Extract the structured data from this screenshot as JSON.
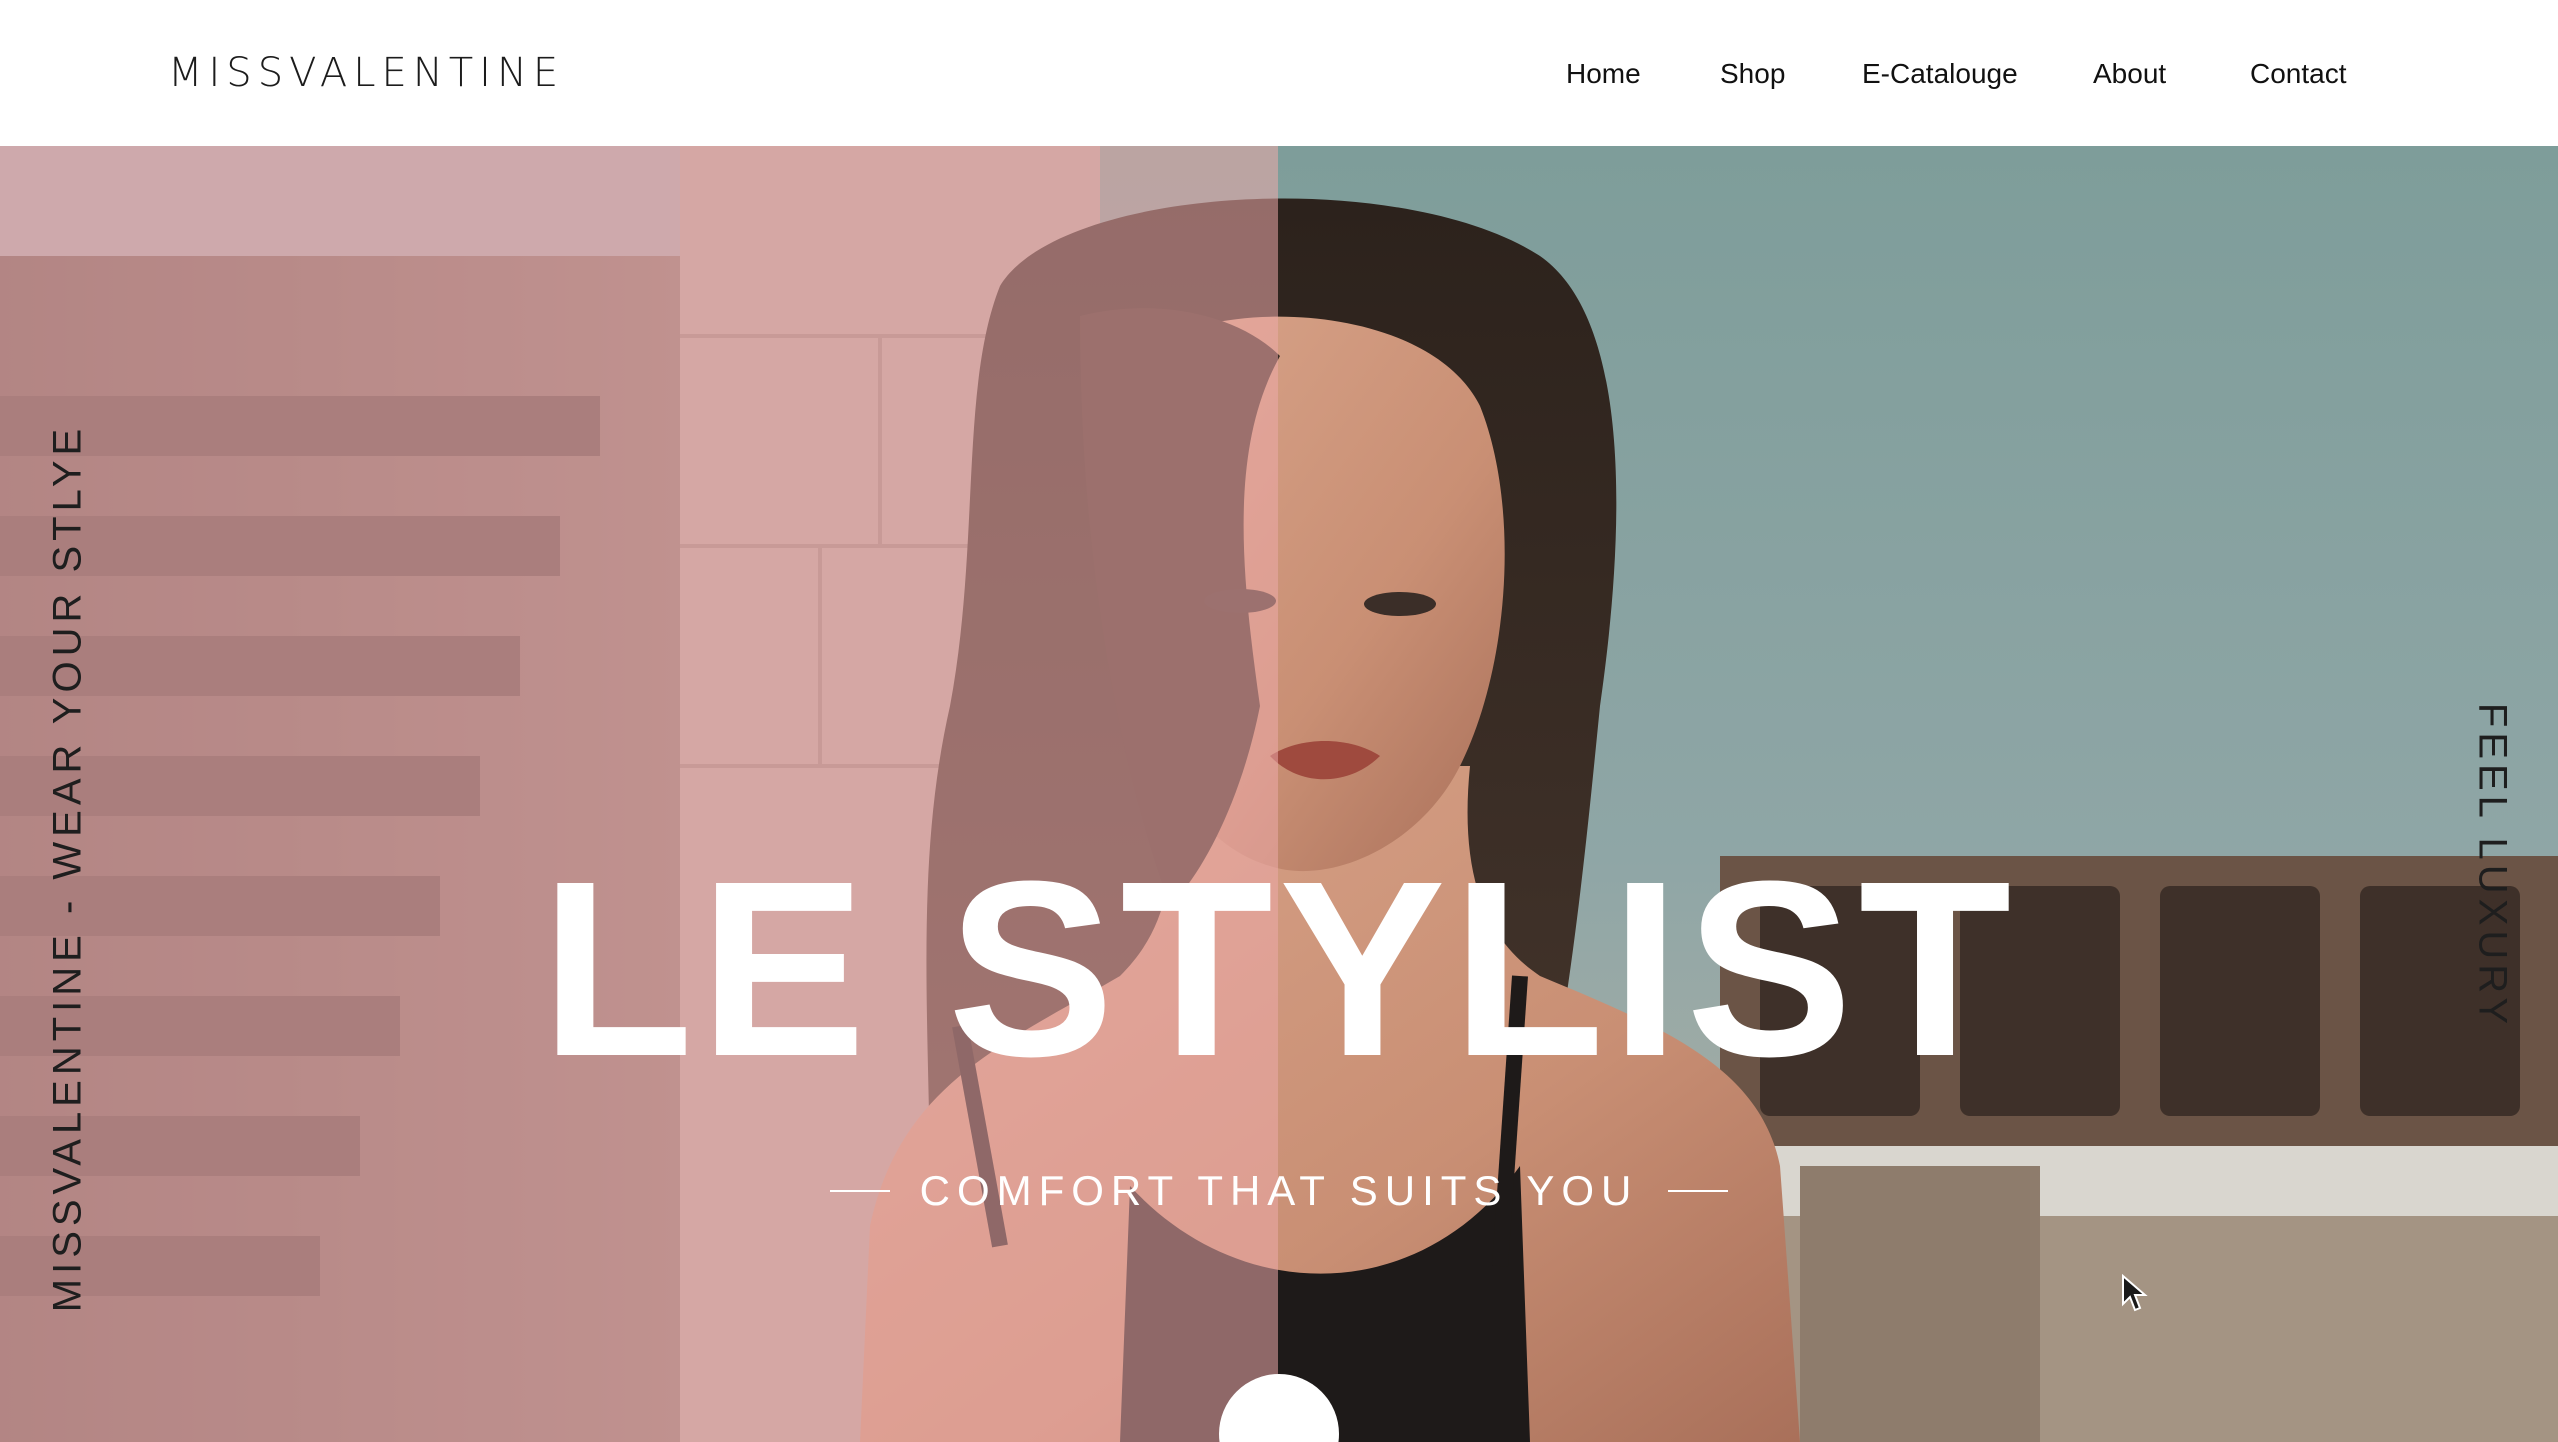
{
  "header": {
    "logo": "MISSVALENTINE",
    "nav": [
      {
        "label": "Home"
      },
      {
        "label": "Shop"
      },
      {
        "label": "E-Catalouge"
      },
      {
        "label": "About"
      },
      {
        "label": "Contact"
      }
    ]
  },
  "hero": {
    "side_left": "MISSVALENTINE - WEAR YOUR STLYE",
    "side_right": "FEEL LUXURY",
    "headline": "LE STYLIST",
    "tagline": "COMFORT THAT SUITS YOU",
    "scroll_icon": "chevron-down-icon",
    "tint_color": "#ECAAAA"
  }
}
